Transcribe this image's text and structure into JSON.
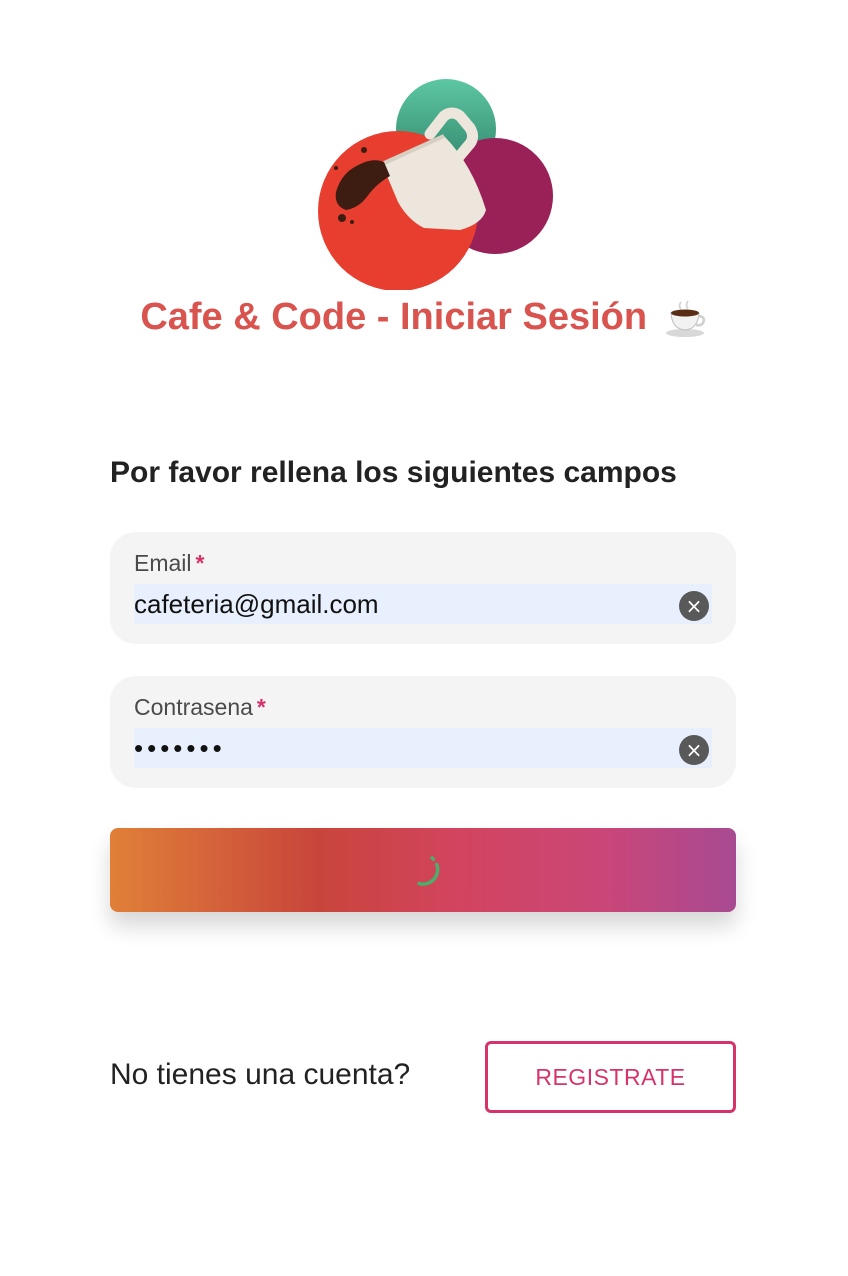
{
  "logo": {
    "icon": "coffee-mug-splash-logo",
    "colors": {
      "red_circle": "#e83e2f",
      "teal_circle": "#4aa888",
      "purple_circle": "#9a2158",
      "mug": "#ece6dc",
      "coffee": "#3d1d12"
    }
  },
  "header": {
    "title": "Cafe & Code - Iniciar Sesión",
    "title_icon": "coffee-cup-icon",
    "title_color": "#d9534f"
  },
  "form": {
    "instructions": "Por favor rellena los siguientes campos",
    "email": {
      "label": "Email",
      "required_marker": "*",
      "value": "cafeteria@gmail.com",
      "clear_icon": "×"
    },
    "password": {
      "label": "Contrasena",
      "required_marker": "*",
      "value_masked": "•••••••",
      "clear_icon": "×"
    },
    "submit": {
      "state": "loading",
      "spinner_icon": "loading-spinner-icon",
      "gradient": [
        "#e08038",
        "#c8453b",
        "#d2445e",
        "#cb4677",
        "#a84a92"
      ]
    }
  },
  "signup": {
    "question": "No tienes una cuenta?",
    "button_label": "REGISTRATE",
    "accent": "#d6336c"
  }
}
